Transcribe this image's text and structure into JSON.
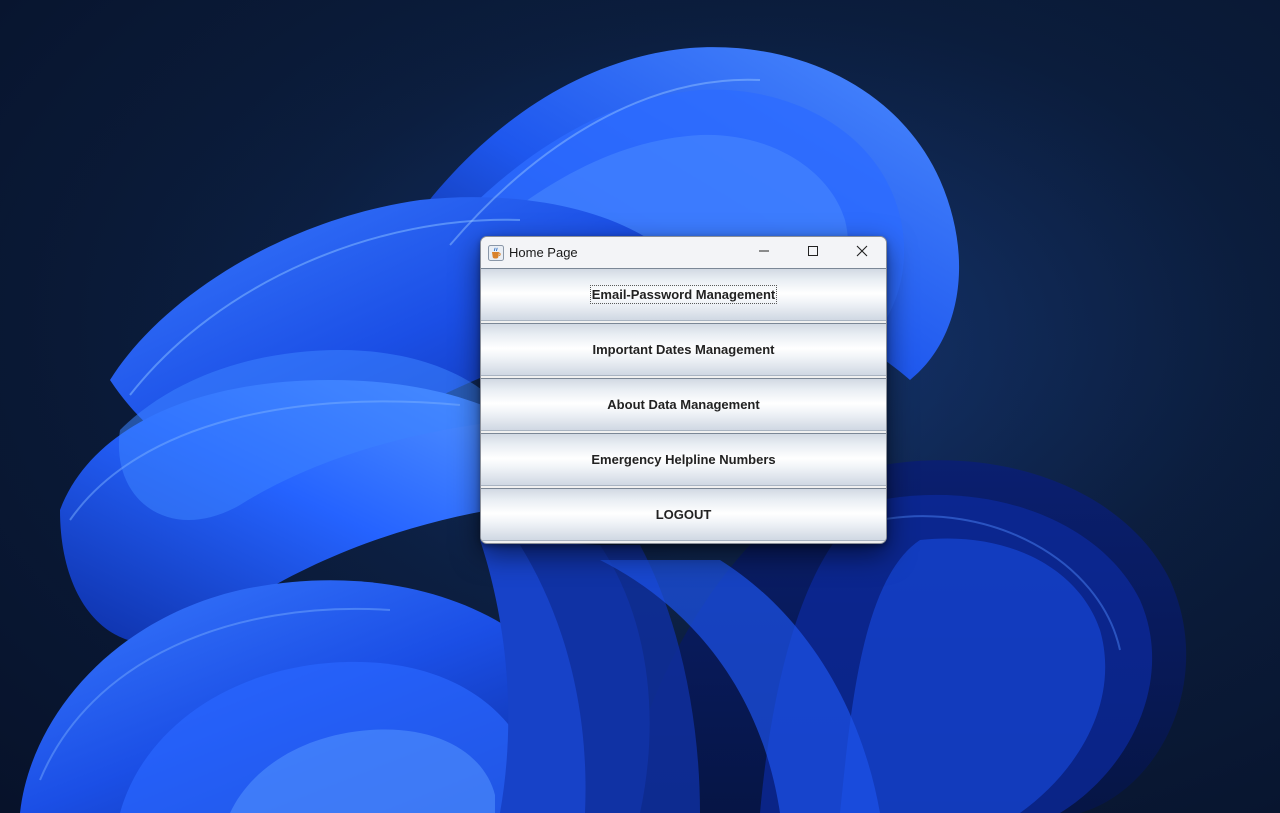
{
  "window": {
    "title": "Home Page",
    "icon": "java-cup-icon",
    "controls": [
      "minimize-icon",
      "maximize-icon",
      "close-icon"
    ]
  },
  "buttons": [
    {
      "label": "Email-Password Management",
      "focused": true
    },
    {
      "label": "Important Dates Management",
      "focused": false
    },
    {
      "label": "About Data Management",
      "focused": false
    },
    {
      "label": "Emergency Helpline Numbers",
      "focused": false
    },
    {
      "label": "LOGOUT",
      "focused": false
    }
  ],
  "colors": {
    "desktop_background": "#0b1d3c",
    "wallpaper_blue": "#1f4fe0",
    "window_background": "#f0f0f0",
    "button_text": "#222222"
  }
}
